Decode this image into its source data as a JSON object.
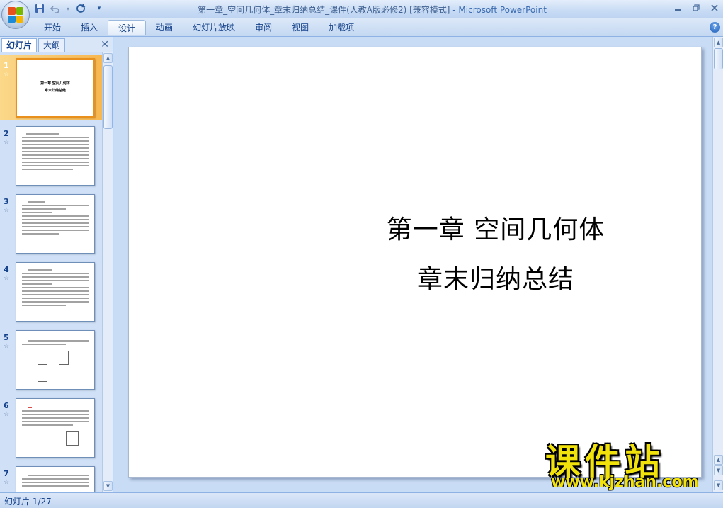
{
  "window": {
    "title": "第一章_空间几何体_章末归纳总结_课件(人教A版必修2) [兼容模式]",
    "app_name": " - Microsoft PowerPoint"
  },
  "ribbon": {
    "tabs": [
      {
        "label": "开始"
      },
      {
        "label": "插入"
      },
      {
        "label": "设计",
        "active": true
      },
      {
        "label": "动画"
      },
      {
        "label": "幻灯片放映"
      },
      {
        "label": "审阅"
      },
      {
        "label": "视图"
      },
      {
        "label": "加载项"
      }
    ]
  },
  "left_pane": {
    "tabs": [
      {
        "label": "幻灯片",
        "active": true
      },
      {
        "label": "大纲"
      }
    ],
    "thumbnails": [
      {
        "number": "1",
        "selected": true,
        "title_lines": [
          "第一章  空间几何体",
          "章末归纳总结"
        ]
      },
      {
        "number": "2"
      },
      {
        "number": "3"
      },
      {
        "number": "4"
      },
      {
        "number": "5"
      },
      {
        "number": "6"
      },
      {
        "number": "7"
      }
    ]
  },
  "slide": {
    "title_line1": "第一章  空间几何体",
    "title_line2": "章末归纳总结"
  },
  "watermark": {
    "main": "课件站",
    "url": "www.kjzhan.com"
  },
  "status": {
    "slide_counter": "幻灯片 1/27"
  },
  "colors": {
    "ribbon_bg": "#c4d8f2",
    "selected_thumb": "#f7b750",
    "watermark": "#f2e20c"
  }
}
